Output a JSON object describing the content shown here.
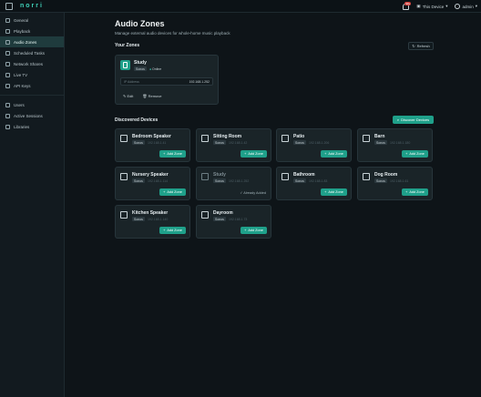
{
  "topbar": {
    "brand": "norri",
    "device": "This Device",
    "user": "admin",
    "badge": "99+"
  },
  "sidebar": {
    "items": [
      {
        "label": "General"
      },
      {
        "label": "Playback"
      },
      {
        "label": "Audio Zones"
      },
      {
        "label": "Scheduled Tasks"
      },
      {
        "label": "Network Shares"
      },
      {
        "label": "Live TV"
      },
      {
        "label": "API Keys"
      },
      {
        "label": "Users"
      },
      {
        "label": "Active Sessions"
      },
      {
        "label": "Libraries"
      }
    ]
  },
  "page": {
    "title": "Audio Zones",
    "subtitle": "Manage external audio devices for whole-home music playback"
  },
  "zones_section": {
    "title": "Your Zones",
    "refresh": "Refresh"
  },
  "zone": {
    "name": "Study",
    "type": "Sonos",
    "status": "Online",
    "address_label": "IP Address",
    "address": "192.168.1.252",
    "edit": "Edit",
    "remove": "Remove"
  },
  "discovered": {
    "title": "Discovered Devices",
    "discover_button": "Discover Devices",
    "add_label": "Add Zone",
    "already_label": "Already Added",
    "devices": [
      {
        "name": "Bedroom Speaker",
        "type": "Sonos",
        "ip": "192.168.1.41"
      },
      {
        "name": "Sitting Room",
        "type": "Sonos",
        "ip": "192.168.1.42"
      },
      {
        "name": "Patio",
        "type": "Sonos",
        "ip": "192.168.1.206"
      },
      {
        "name": "Barn",
        "type": "Sonos",
        "ip": "192.168.1.180"
      },
      {
        "name": "Nursery Speaker",
        "type": "Sonos",
        "ip": "192.168.1.114"
      },
      {
        "name": "Study",
        "type": "Sonos",
        "ip": "192.168.1.252"
      },
      {
        "name": "Bathroom",
        "type": "Sonos",
        "ip": "192.168.1.83"
      },
      {
        "name": "Dog Room",
        "type": "Sonos",
        "ip": "192.168.1.61"
      },
      {
        "name": "Kitchen Speaker",
        "type": "Sonos",
        "ip": "192.168.1.140"
      },
      {
        "name": "Dayroom",
        "type": "Sonos",
        "ip": "192.168.1.73"
      }
    ]
  },
  "colors": {
    "accent": "#1fa08a",
    "background": "#0e1418",
    "card": "#1a2428"
  }
}
